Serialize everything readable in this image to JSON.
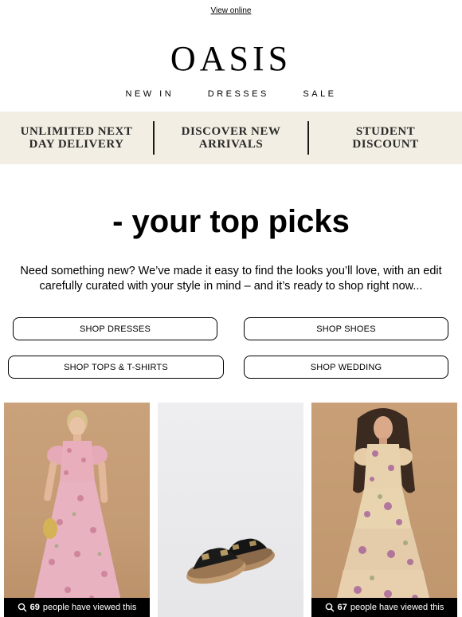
{
  "header": {
    "view_online": "View online",
    "logo": "OASIS",
    "nav": [
      "NEW IN",
      "DRESSES",
      "SALE"
    ]
  },
  "benefits": [
    {
      "line1": "UNLIMITED NEXT",
      "line2": "DAY DELIVERY"
    },
    {
      "line1": "DISCOVER NEW",
      "line2": "ARRIVALS"
    },
    {
      "line1": "STUDENT",
      "line2": "DISCOUNT"
    }
  ],
  "main": {
    "headline": "- your top picks",
    "intro": "Need something new? We’ve made it easy to find the looks you’ll love, with an edit carefully curated with your style in mind – and it’s ready to shop right now...",
    "buttons": [
      "SHOP DRESSES",
      "SHOP SHOES",
      "SHOP TOPS & T-SHIRTS",
      "SHOP WEDDING"
    ]
  },
  "products": [
    {
      "views_count": "69",
      "views_text": "people have viewed this",
      "image": "pink-floral-maxi-dress-photo"
    },
    {
      "image": "black-cutout-double-buckle-sandals-photo"
    },
    {
      "views_count": "67",
      "views_text": "people have viewed this",
      "image": "floral-chiffon-maxi-dress-photo"
    }
  ],
  "colors": {
    "benefit_bar": "#f3eee3",
    "text": "#000000",
    "views_bar": "#000000"
  },
  "icons": {
    "views": "search-icon"
  }
}
